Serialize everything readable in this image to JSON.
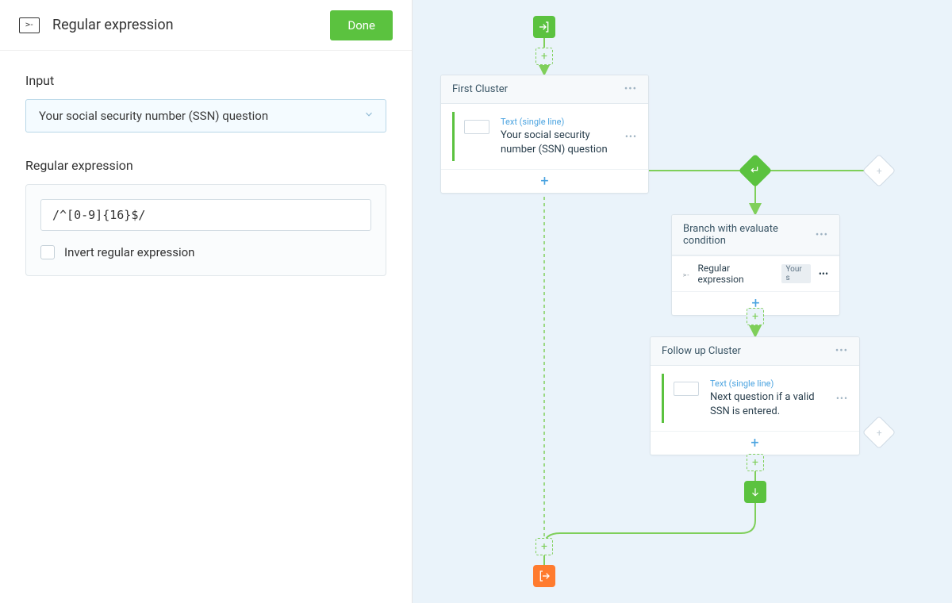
{
  "colors": {
    "accent_green": "#5bc23f",
    "accent_orange": "#ff7b2e",
    "canvas_bg": "#eaf3fa",
    "link_blue": "#4aa3e0"
  },
  "panel": {
    "icon_glyph": ">-",
    "title": "Regular expression",
    "done_label": "Done",
    "input_label": "Input",
    "input_value": "Your social security number (SSN) question",
    "regex_label": "Regular expression",
    "regex_value": "/^[0-9]{16}$/",
    "invert_label": "Invert regular expression",
    "invert_checked": false
  },
  "flow": {
    "entry_icon": "enter-icon",
    "exit_icon": "exit-icon",
    "cluster1": {
      "title": "First Cluster",
      "item_type": "Text (single line)",
      "item_title": "Your social security number (SSN) question"
    },
    "branch": {
      "title": "Branch with evaluate condition",
      "rule_label": "Regular expression",
      "rule_tag": "Your s"
    },
    "cluster2": {
      "title": "Follow up Cluster",
      "item_type": "Text (single line)",
      "item_title": "Next question if a valid SSN is entered."
    }
  }
}
